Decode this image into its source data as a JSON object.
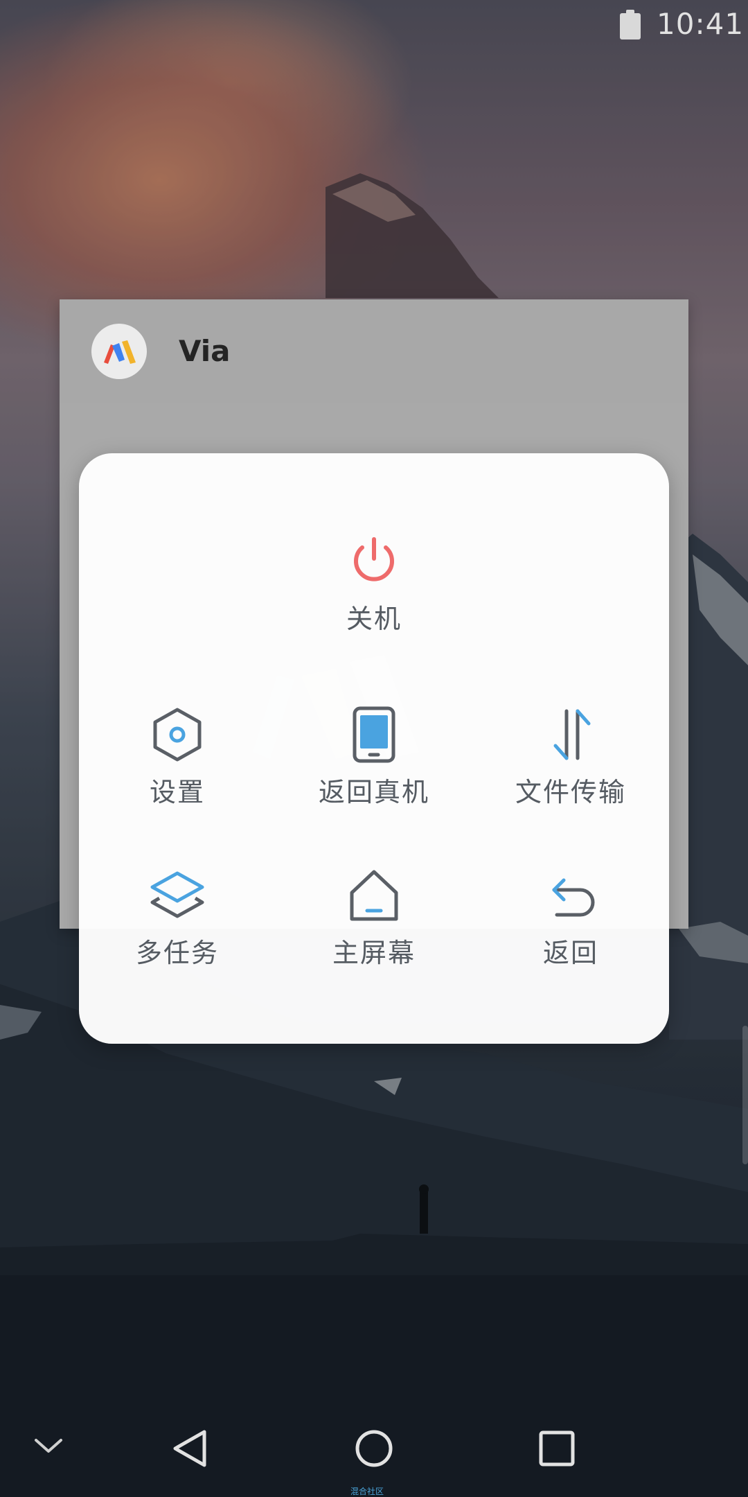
{
  "status_bar": {
    "time": "10:41",
    "battery_icon": "battery-full-icon"
  },
  "recent_app": {
    "title": "Via",
    "icon": "via-app-icon"
  },
  "menu": {
    "power": {
      "label": "关机",
      "icon": "power-icon",
      "color": "#ee6b6b"
    },
    "items": [
      {
        "label": "设置",
        "icon": "settings-hexagon-icon"
      },
      {
        "label": "返回真机",
        "icon": "phone-device-icon"
      },
      {
        "label": "文件传输",
        "icon": "file-transfer-icon"
      },
      {
        "label": "多任务",
        "icon": "multitask-layers-icon"
      },
      {
        "label": "主屏幕",
        "icon": "home-icon"
      },
      {
        "label": "返回",
        "icon": "back-arrow-icon"
      }
    ],
    "accent_color": "#4aa3e0",
    "icon_color": "#5a5f66"
  },
  "nav_bar": {
    "collapse_icon": "chevron-down-icon",
    "back_icon": "triangle-back-icon",
    "home_icon": "circle-home-icon",
    "recents_icon": "square-recents-icon"
  },
  "watermark": "混合社区"
}
